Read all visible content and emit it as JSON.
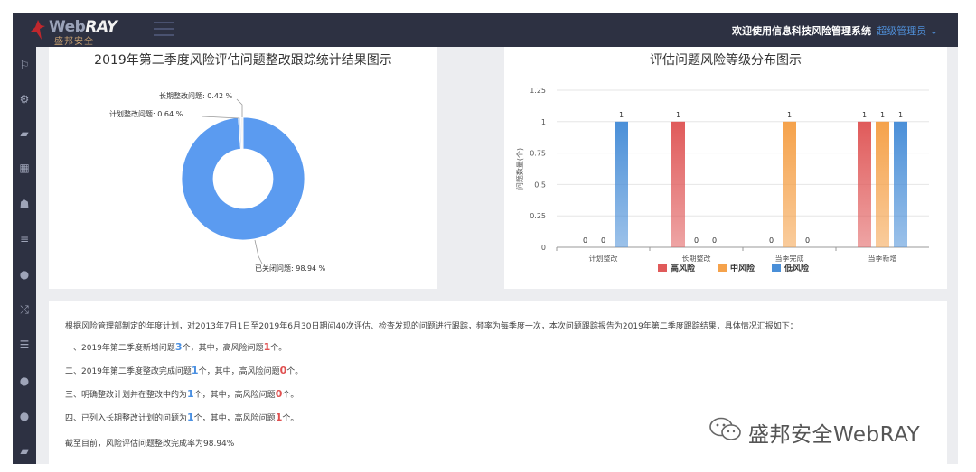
{
  "header": {
    "logo_en_prefix": "Web",
    "logo_en_suffix": "RAY",
    "logo_cn": "盛邦安全",
    "welcome": "欢迎使用信息科技风险管理系统",
    "user": "超级管理员"
  },
  "sidebar": {
    "icons": [
      "flag-icon",
      "gear-icon",
      "briefcase-icon",
      "calendar-icon",
      "users-icon",
      "list-icon",
      "help-icon",
      "shuffle-icon",
      "numbered-list-icon",
      "help-icon-2",
      "help-icon-3",
      "briefcase-icon-2"
    ]
  },
  "pie_panel": {
    "title": "2019年第二季度风险评估问题整改跟踪统计结果图示",
    "chart_data": {
      "type": "pie",
      "title": "2019年第二季度风险评估问题整改跟踪统计结果图示",
      "slices": [
        {
          "label": "已关闭问题",
          "value": 98.94,
          "display": "已关闭问题: 98.94 %",
          "color": "#5b9bf0"
        },
        {
          "label": "计划整改问题",
          "value": 0.64,
          "display": "计划整改问题: 0.64 %",
          "color": "#d9e6f7"
        },
        {
          "label": "长期整改问题",
          "value": 0.42,
          "display": "长期整改问题: 0.42 %",
          "color": "#f2f2f2"
        }
      ]
    }
  },
  "bar_panel": {
    "title": "评估问题风险等级分布图示",
    "chart_data": {
      "type": "bar",
      "title": "评估问题风险等级分布图示",
      "ylabel": "问题数量(个)",
      "ylim": [
        0,
        1.25
      ],
      "yticks": [
        "0",
        "0.25",
        "0.5",
        "0.75",
        "1",
        "1.25"
      ],
      "categories": [
        "计划整改",
        "长期整改",
        "当季完成",
        "当季新增"
      ],
      "series": [
        {
          "name": "高风险",
          "color": "#e05a5a",
          "values": [
            0,
            1,
            0,
            1
          ]
        },
        {
          "name": "中风险",
          "color": "#f5a24b",
          "values": [
            0,
            0,
            1,
            1
          ]
        },
        {
          "name": "低风险",
          "color": "#4a8fd8",
          "values": [
            1,
            0,
            0,
            1
          ]
        }
      ],
      "legend": "bottom",
      "grid": true
    }
  },
  "report": {
    "intro": "根据风险管理部制定的年度计划，对2013年7月1日至2019年6月30日期间40次评估、检查发现的问题进行跟踪，频率为每季度一次，本次问题跟踪报告为2019年第二季度跟踪结果，具体情况汇报如下：",
    "l1a": "一、2019年第二季度新增问题",
    "l1b": "3",
    "l1c": "个，其中，高风险问题",
    "l1d": "1",
    "l1e": "个。",
    "l2a": "二、2019年第二季度整改完成问题",
    "l2b": "1",
    "l2c": "个，其中，高风险问题",
    "l2d": "0",
    "l2e": "个。",
    "l3a": "三、明确整改计划并在整改中的为",
    "l3b": "1",
    "l3c": "个，其中，高风险问题",
    "l3d": "0",
    "l3e": "个。",
    "l4a": "四、已列入长期整改计划的问题为",
    "l4b": "1",
    "l4c": "个，其中，高风险问题",
    "l4d": "1",
    "l4e": "个。",
    "summary": "截至目前，风险评估问题整改完成率为98.94%"
  },
  "watermark": {
    "text": "盛邦安全WebRAY"
  }
}
